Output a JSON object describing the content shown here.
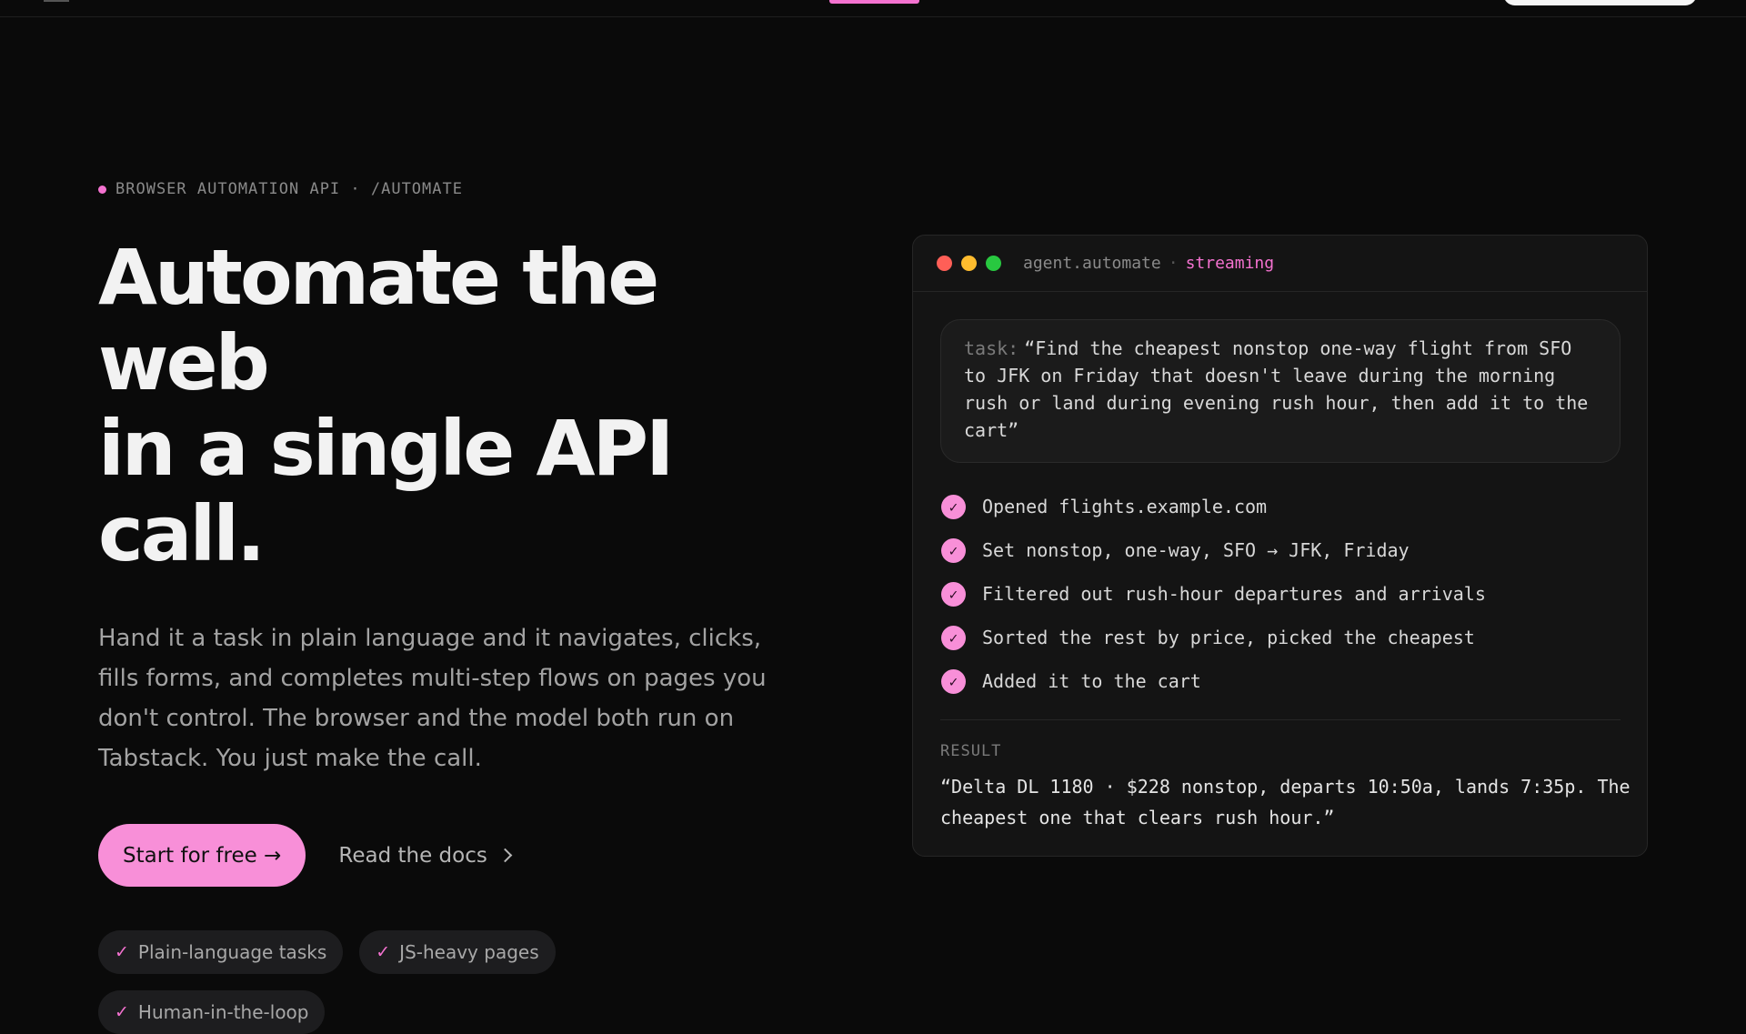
{
  "nav": {
    "menu_icon": "menu-icon"
  },
  "hero": {
    "eyebrow": "BROWSER AUTOMATION API · /AUTOMATE",
    "headline_line1": "Automate the web",
    "headline_line2": "in a single API call.",
    "lede": "Hand it a task in plain language and it navigates, clicks, fills forms, and completes multi-step flows on pages you don't control. The browser and the model both run on Tabstack. You just make the call.",
    "primary_cta": "Start for free →",
    "secondary_cta": "Read the docs",
    "chips": [
      {
        "label": "Plain-language tasks"
      },
      {
        "label": "JS-heavy pages"
      },
      {
        "label": "Human-in-the-loop"
      }
    ],
    "chip_check": "✓"
  },
  "terminal": {
    "title": "agent.automate",
    "separator": "·",
    "status": "streaming",
    "task_prefix": "task:",
    "task_text": "“Find the cheapest nonstop one-way flight from SFO to JFK on Friday that doesn't leave during the morning rush or land during evening rush hour, then add it to the cart”",
    "step_check": "✓",
    "steps": [
      {
        "label": "Opened flights.example.com"
      },
      {
        "label": "Set nonstop, one-way, SFO → JFK, Friday"
      },
      {
        "label": "Filtered out rush-hour departures and arrivals"
      },
      {
        "label": "Sorted the rest by price, picked the cheapest"
      },
      {
        "label": "Added it to the cart"
      }
    ],
    "result_label": "RESULT",
    "result_text": "“Delta DL 1180 · $228 nonstop, departs 10:50a, lands 7:35p. The cheapest one that clears rush hour.”"
  },
  "colors": {
    "accent": "#f472d0",
    "button": "#f88fd8",
    "background": "#0a0a0a"
  }
}
